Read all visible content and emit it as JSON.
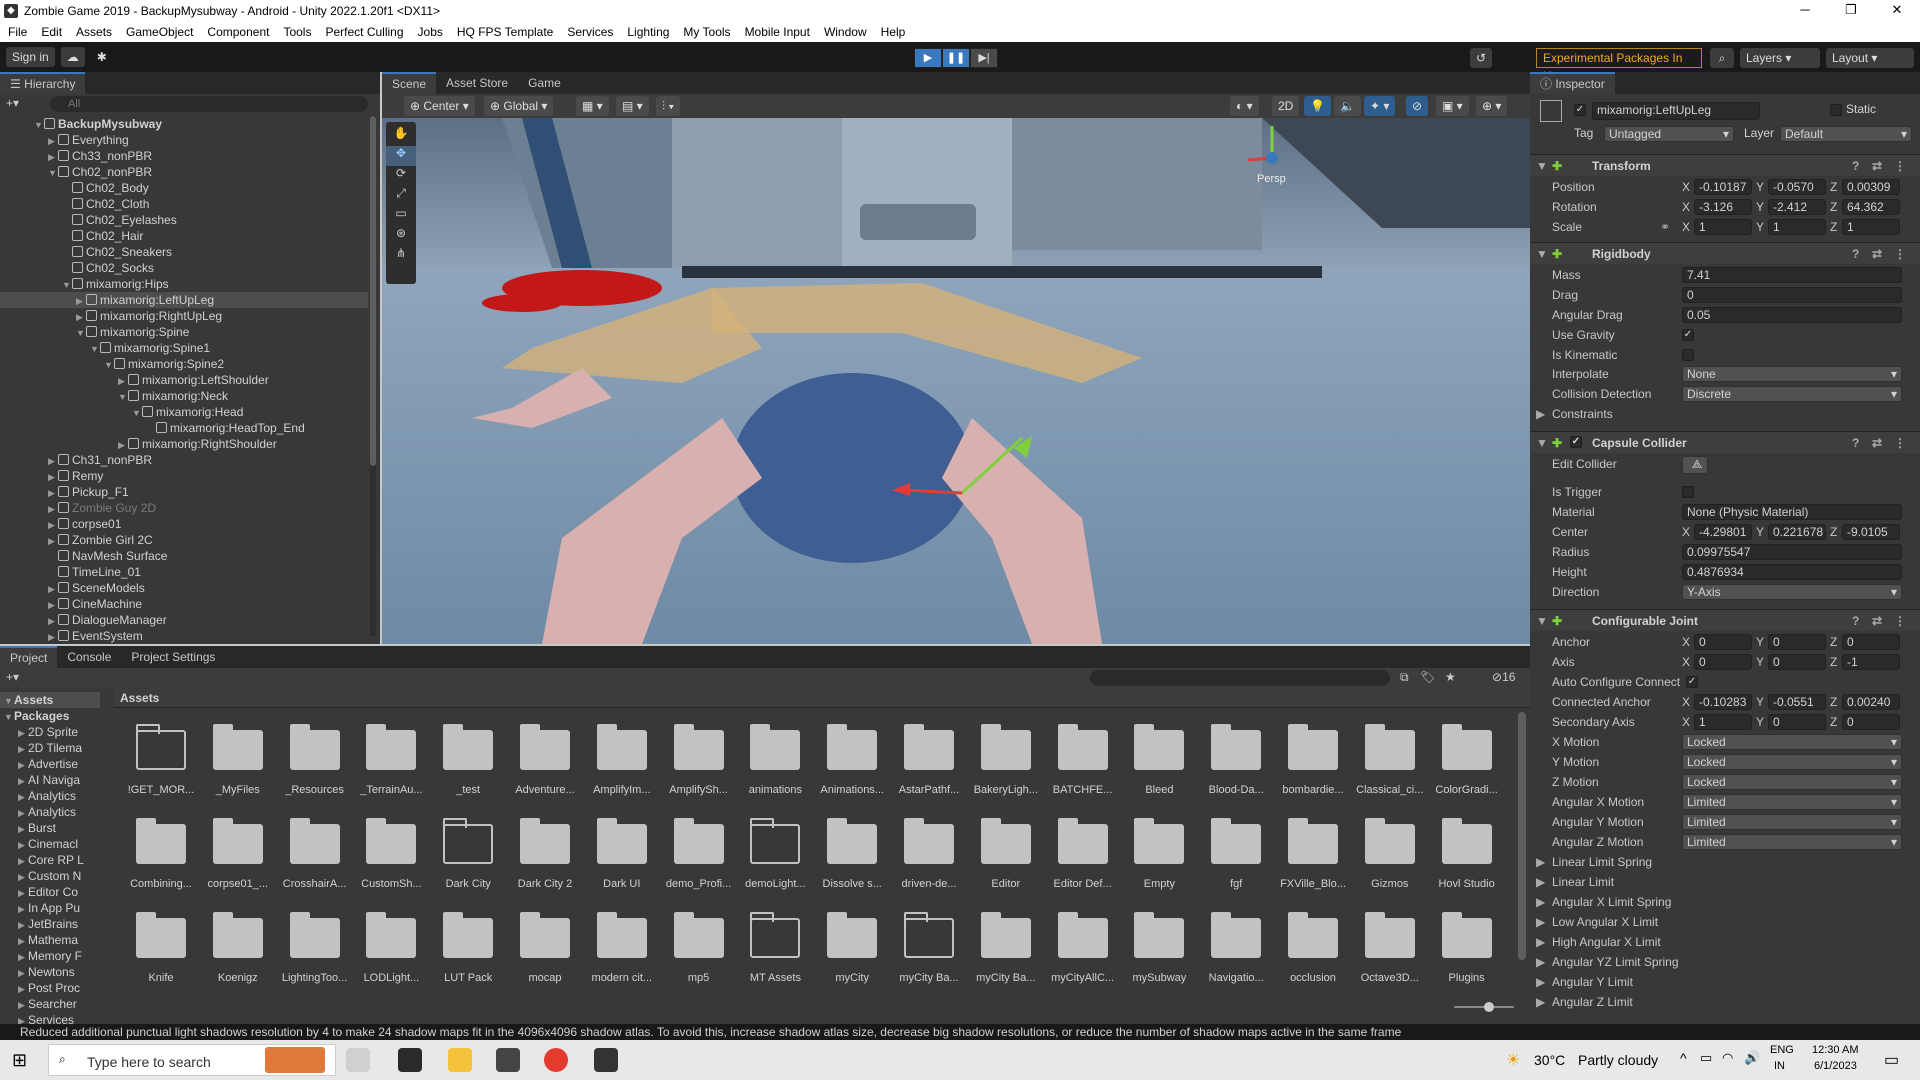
{
  "title": "Zombie Game 2019 - BackupMysubway - Android - Unity 2022.1.20f1 <DX11>",
  "menu": [
    "File",
    "Edit",
    "Assets",
    "GameObject",
    "Component",
    "Tools",
    "Perfect Culling",
    "Jobs",
    "HQ FPS Template",
    "Services",
    "Lighting",
    "My Tools",
    "Mobile Input",
    "Window",
    "Help"
  ],
  "toolbar": {
    "sign_in": "Sign in",
    "experimental": "Experimental Packages In Use ▾",
    "layers": "Layers",
    "layout": "Layout"
  },
  "hierarchy": {
    "tab": "Hierarchy",
    "search_placeholder": "All",
    "rows": [
      {
        "t": "BackupMysubway",
        "d": 0,
        "arr": "▼",
        "bold": true
      },
      {
        "t": "Everything",
        "d": 1,
        "arr": "▶"
      },
      {
        "t": "Ch33_nonPBR",
        "d": 1,
        "arr": "▶"
      },
      {
        "t": "Ch02_nonPBR",
        "d": 1,
        "arr": "▼"
      },
      {
        "t": "Ch02_Body",
        "d": 2,
        "arr": ""
      },
      {
        "t": "Ch02_Cloth",
        "d": 2,
        "arr": ""
      },
      {
        "t": "Ch02_Eyelashes",
        "d": 2,
        "arr": ""
      },
      {
        "t": "Ch02_Hair",
        "d": 2,
        "arr": ""
      },
      {
        "t": "Ch02_Sneakers",
        "d": 2,
        "arr": ""
      },
      {
        "t": "Ch02_Socks",
        "d": 2,
        "arr": ""
      },
      {
        "t": "mixamorig:Hips",
        "d": 2,
        "arr": "▼"
      },
      {
        "t": "mixamorig:LeftUpLeg",
        "d": 3,
        "arr": "▶",
        "sel": true
      },
      {
        "t": "mixamorig:RightUpLeg",
        "d": 3,
        "arr": "▶"
      },
      {
        "t": "mixamorig:Spine",
        "d": 3,
        "arr": "▼"
      },
      {
        "t": "mixamorig:Spine1",
        "d": 4,
        "arr": "▼"
      },
      {
        "t": "mixamorig:Spine2",
        "d": 5,
        "arr": "▼"
      },
      {
        "t": "mixamorig:LeftShoulder",
        "d": 6,
        "arr": "▶"
      },
      {
        "t": "mixamorig:Neck",
        "d": 6,
        "arr": "▼"
      },
      {
        "t": "mixamorig:Head",
        "d": 7,
        "arr": "▼"
      },
      {
        "t": "mixamorig:HeadTop_End",
        "d": 8,
        "arr": ""
      },
      {
        "t": "mixamorig:RightShoulder",
        "d": 6,
        "arr": "▶"
      },
      {
        "t": "Ch31_nonPBR",
        "d": 1,
        "arr": "▶"
      },
      {
        "t": "Remy",
        "d": 1,
        "arr": "▶"
      },
      {
        "t": "Pickup_F1",
        "d": 1,
        "arr": "▶"
      },
      {
        "t": "Zombie Guy 2D",
        "d": 1,
        "arr": "▶",
        "dim": true
      },
      {
        "t": "corpse01",
        "d": 1,
        "arr": "▶"
      },
      {
        "t": "Zombie Girl 2C",
        "d": 1,
        "arr": "▶"
      },
      {
        "t": "NavMesh Surface",
        "d": 1,
        "arr": ""
      },
      {
        "t": "TimeLine_01",
        "d": 1,
        "arr": ""
      },
      {
        "t": "SceneModels",
        "d": 1,
        "arr": "▶"
      },
      {
        "t": "CineMachine",
        "d": 1,
        "arr": "▶"
      },
      {
        "t": "DialogueManager",
        "d": 1,
        "arr": "▶"
      },
      {
        "t": "EventSystem",
        "d": 1,
        "arr": "▶"
      }
    ]
  },
  "scene_tabs": [
    "Scene",
    "Asset Store",
    "Game"
  ],
  "scene_toolbar": {
    "pivot": "Center",
    "space": "Global",
    "mode2d": "2D",
    "persp": "Persp"
  },
  "inspector": {
    "tab": "Inspector",
    "object_name": "mixamorig:LeftUpLeg",
    "static": "Static",
    "tag_label": "Tag",
    "tag": "Untagged",
    "layer_label": "Layer",
    "layer": "Default",
    "transform": {
      "title": "Transform",
      "position": [
        "-0.10187",
        "-0.0570",
        "0.00309"
      ],
      "rotation": [
        "-3.126",
        "-2.412",
        "64.362"
      ],
      "scale": [
        "1",
        "1",
        "1"
      ]
    },
    "rigidbody": {
      "title": "Rigidbody",
      "mass": "7.41",
      "drag": "0",
      "angular_drag": "0.05",
      "interpolate": "None",
      "collision": "Discrete"
    },
    "capsule": {
      "title": "Capsule Collider",
      "material": "None (Physic Material)",
      "center": [
        "-4.29801",
        "0.221678",
        "-9.0105"
      ],
      "radius": "0.09975547",
      "height": "0.4876934",
      "direction": "Y-Axis"
    },
    "joint": {
      "title": "Configurable Joint",
      "anchor": [
        "0",
        "0",
        "0"
      ],
      "axis": [
        "0",
        "0",
        "-1"
      ],
      "connected": [
        "-0.10283",
        "-0.0551",
        "0.00240"
      ],
      "secondary": [
        "1",
        "0",
        "0"
      ],
      "motions": [
        [
          "X Motion",
          "Locked"
        ],
        [
          "Y Motion",
          "Locked"
        ],
        [
          "Z Motion",
          "Locked"
        ],
        [
          "Angular X Motion",
          "Limited"
        ],
        [
          "Angular Y Motion",
          "Limited"
        ],
        [
          "Angular Z Motion",
          "Limited"
        ]
      ],
      "foldouts": [
        "Linear Limit Spring",
        "Linear Limit",
        "Angular X Limit Spring",
        "Low Angular X Limit",
        "High Angular X Limit",
        "Angular YZ Limit Spring",
        "Angular Y Limit",
        "Angular Z Limit"
      ]
    },
    "labels": {
      "position": "Position",
      "rotation": "Rotation",
      "scale": "Scale",
      "mass": "Mass",
      "drag": "Drag",
      "angular_drag": "Angular Drag",
      "use_gravity": "Use Gravity",
      "is_kinematic": "Is Kinematic",
      "interpolate": "Interpolate",
      "collision": "Collision Detection",
      "constraints": "Constraints",
      "edit_collider": "Edit Collider",
      "is_trigger": "Is Trigger",
      "material": "Material",
      "center": "Center",
      "radius": "Radius",
      "height": "Height",
      "direction": "Direction",
      "anchor": "Anchor",
      "axis": "Axis",
      "auto_configure": "Auto Configure Connect",
      "connected_anchor": "Connected Anchor",
      "secondary_axis": "Secondary Axis"
    }
  },
  "project": {
    "tabs": [
      "Project",
      "Console",
      "Project Settings"
    ],
    "count": "16",
    "breadcrumb": "Assets",
    "tree": [
      {
        "t": "Assets",
        "bold": true
      },
      {
        "t": "Packages",
        "bold": true
      },
      {
        "t": "2D Sprite"
      },
      {
        "t": "2D Tilema"
      },
      {
        "t": "Advertise"
      },
      {
        "t": "AI Naviga"
      },
      {
        "t": "Analytics"
      },
      {
        "t": "Analytics"
      },
      {
        "t": "Burst"
      },
      {
        "t": "Cinemacl"
      },
      {
        "t": "Core RP L"
      },
      {
        "t": "Custom N"
      },
      {
        "t": "Editor Co"
      },
      {
        "t": "In App Pu"
      },
      {
        "t": "JetBrains"
      },
      {
        "t": "Mathema"
      },
      {
        "t": "Memory F"
      },
      {
        "t": "Newtons"
      },
      {
        "t": "Post Proc"
      },
      {
        "t": "Searcher"
      },
      {
        "t": "Services"
      }
    ],
    "folders": [
      [
        "!GET_MOR...",
        "_MyFiles",
        "_Resources",
        "_TerrainAu...",
        "_test",
        "Adventure...",
        "AmplifyIm...",
        "AmplifySh...",
        "animations",
        "Animations...",
        "AstarPathf...",
        "BakeryLigh...",
        "BATCHFE...",
        "Bleed",
        "Blood-Da...",
        "bombardie...",
        "Classical_ci...",
        "ColorGradi..."
      ],
      [
        "Combining...",
        "corpse01_...",
        "CrosshairA...",
        "CustomSh...",
        "Dark City",
        "Dark City 2",
        "Dark UI",
        "demo_Profi...",
        "demoLight...",
        "Dissolve s...",
        "driven-de...",
        "Editor",
        "Editor Def...",
        "Empty",
        "fgf",
        "FXVille_Blo...",
        "Gizmos",
        "Hovl Studio"
      ],
      [
        "Knife",
        "Koenigz",
        "LightingToo...",
        "LODLight...",
        "LUT Pack",
        "mocap",
        "modern cit...",
        "mp5",
        "MT Assets",
        "myCity",
        "myCity Ba...",
        "myCity Ba...",
        "myCityAllC...",
        "mySubway",
        "Navigatio...",
        "occlusion",
        "Octave3D...",
        "Plugins"
      ]
    ]
  },
  "status": "Reduced additional punctual light shadows resolution by 4 to make 24 shadow maps fit in the 4096x4096 shadow atlas. To avoid this, increase shadow atlas size, decrease big shadow resolutions, or reduce the number of shadow maps active in the same frame",
  "taskbar": {
    "search": "Type here to search",
    "weather_temp": "30°C",
    "weather": "Partly cloudy",
    "lang1": "ENG",
    "lang2": "IN",
    "time": "12:30 AM",
    "date": "6/1/2023"
  }
}
